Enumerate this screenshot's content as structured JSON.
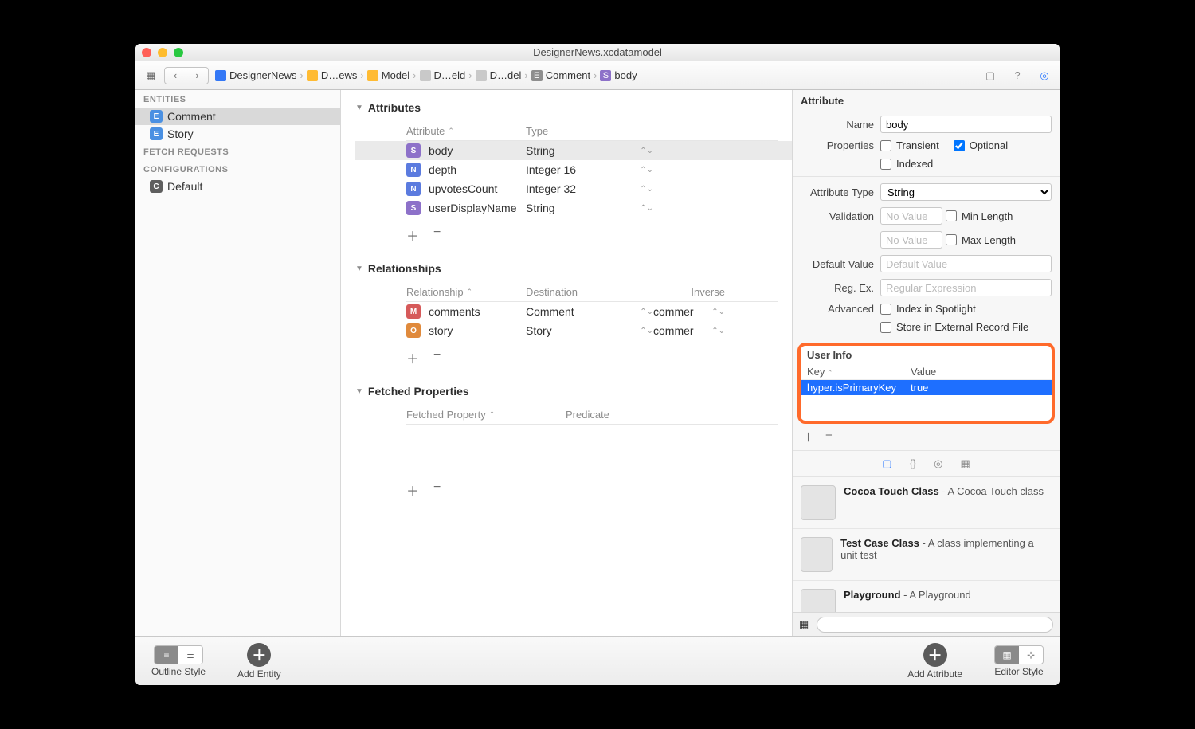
{
  "window": {
    "title": "DesignerNews.xcdatamodel"
  },
  "toolbar": {
    "breadcrumb": [
      {
        "label": "DesignerNews",
        "icon": "blue"
      },
      {
        "label": "D…ews",
        "icon": "folder"
      },
      {
        "label": "Model",
        "icon": "folder"
      },
      {
        "label": "D…eld",
        "icon": "doc"
      },
      {
        "label": "D…del",
        "icon": "doc"
      },
      {
        "label": "Comment",
        "icon": "e"
      },
      {
        "label": "body",
        "icon": "s"
      }
    ]
  },
  "sidebar": {
    "entities_header": "ENTITIES",
    "entities": [
      {
        "label": "Comment",
        "selected": true
      },
      {
        "label": "Story",
        "selected": false
      }
    ],
    "fetch_header": "FETCH REQUESTS",
    "config_header": "CONFIGURATIONS",
    "configs": [
      {
        "label": "Default"
      }
    ]
  },
  "main": {
    "attributes": {
      "header": "Attributes",
      "col_a": "Attribute",
      "col_b": "Type",
      "rows": [
        {
          "tag": "S",
          "name": "body",
          "type": "String",
          "selected": true
        },
        {
          "tag": "N",
          "name": "depth",
          "type": "Integer 16"
        },
        {
          "tag": "N",
          "name": "upvotesCount",
          "type": "Integer 32"
        },
        {
          "tag": "S",
          "name": "userDisplayName",
          "type": "String"
        }
      ]
    },
    "relationships": {
      "header": "Relationships",
      "col_a": "Relationship",
      "col_b": "Destination",
      "col_c": "Inverse",
      "rows": [
        {
          "tag": "M",
          "name": "comments",
          "dest": "Comment",
          "inv": "commer"
        },
        {
          "tag": "O",
          "name": "story",
          "dest": "Story",
          "inv": "commer"
        }
      ]
    },
    "fetched": {
      "header": "Fetched Properties",
      "col_a": "Fetched Property",
      "col_b": "Predicate"
    }
  },
  "footer": {
    "outline_label": "Outline Style",
    "add_entity_label": "Add Entity",
    "add_attribute_label": "Add Attribute",
    "editor_style_label": "Editor Style"
  },
  "inspector": {
    "section": "Attribute",
    "name_label": "Name",
    "name_value": "body",
    "properties_label": "Properties",
    "transient_label": "Transient",
    "optional_label": "Optional",
    "indexed_label": "Indexed",
    "type_label": "Attribute Type",
    "type_value": "String",
    "validation_label": "Validation",
    "novalue_placeholder": "No Value",
    "minlen_label": "Min Length",
    "maxlen_label": "Max Length",
    "default_label": "Default Value",
    "default_placeholder": "Default Value",
    "regex_label": "Reg. Ex.",
    "regex_placeholder": "Regular Expression",
    "advanced_label": "Advanced",
    "spotlight_label": "Index in Spotlight",
    "external_label": "Store in External Record File",
    "userinfo": {
      "header": "User Info",
      "key_col": "Key",
      "value_col": "Value",
      "rows": [
        {
          "key": "hyper.isPrimaryKey",
          "value": "true"
        }
      ]
    },
    "templates": [
      {
        "title": "Cocoa Touch Class",
        "desc": " - A Cocoa Touch class"
      },
      {
        "title": "Test Case Class",
        "desc": " - A class implementing a unit test"
      },
      {
        "title": "Playground",
        "desc": " - A Playground"
      }
    ]
  }
}
